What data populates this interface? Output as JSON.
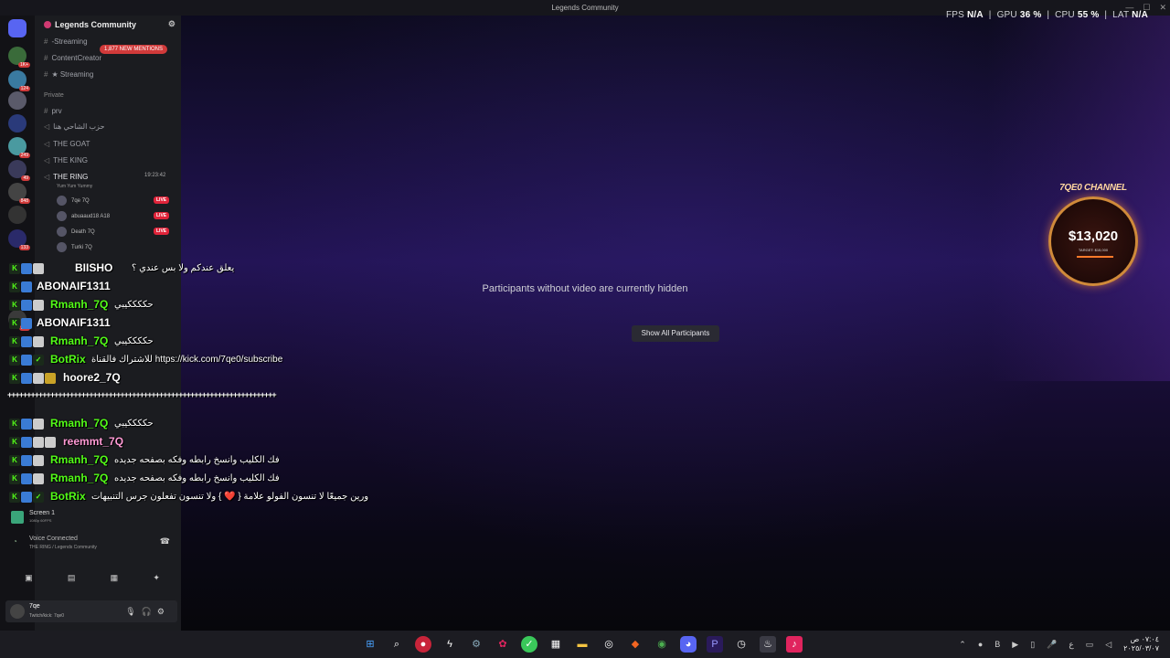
{
  "window": {
    "title": "Legends Community",
    "controls": [
      "—",
      "☐",
      "✕"
    ]
  },
  "stats": {
    "fps_label": "FPS",
    "fps": "N/A",
    "gpu_label": "GPU",
    "gpu": "36 %",
    "cpu_label": "CPU",
    "cpu": "55 %",
    "lat_label": "LAT",
    "lat": "N/A"
  },
  "stage": {
    "hidden_message": "Participants without video are currently hidden",
    "show_button": "Show All Participants"
  },
  "channel_widget": {
    "name": "7QE0 CHANNEL",
    "amount": "$13,020",
    "target": "TARGET: $15,000",
    "accent": "#d08a3a",
    "progress": 0.87
  },
  "discord": {
    "server_name": "Legends Community",
    "mentions_badge": "1,877 NEW MENTIONS",
    "server_badges": [
      "1K+",
      "124",
      "249",
      "49",
      "848",
      "133",
      "907"
    ],
    "channels": [
      {
        "name": "-Streaming"
      },
      {
        "name": "ContentCreator"
      },
      {
        "name": "★ Streaming"
      }
    ],
    "category_private": "Private",
    "private_channels": [
      "prv",
      "حزب الشاحي هنا",
      "THE GOAT",
      "THE KING"
    ],
    "voice_channel": {
      "name": "THE RING",
      "status": "Yum Yum Yummy",
      "timer": "19:23:42"
    },
    "voice_users": [
      {
        "name": "7qe",
        "tag": "7Q",
        "live": "LIVE"
      },
      {
        "name": "abuaaud18",
        "tag": "A18",
        "live": "LIVE"
      },
      {
        "name": "Death",
        "tag": "7Q",
        "live": "LIVE"
      },
      {
        "name": "Turki",
        "tag": "7Q"
      }
    ],
    "screen": {
      "title": "Screen 1",
      "detail": "1080p 60FPS"
    },
    "voice_connected": {
      "title": "Voice Connected",
      "detail": "THE RING / Legends Community"
    },
    "user": {
      "name": "7qe",
      "status": "Twitch/kick: 7qe0"
    }
  },
  "chat": [
    {
      "user": "BIISHO",
      "text": "يعلق عندكم ولا بس عندي ؟",
      "color": "#ffffff"
    },
    {
      "user": "ABONAIF1311",
      "text": "",
      "color": "#ffffff"
    },
    {
      "user": "Rmanh_7Q",
      "text": "حككككيبي",
      "color": "#53fc18"
    },
    {
      "user": "ABONAIF1311",
      "text": "",
      "color": "#ffffff"
    },
    {
      "user": "Rmanh_7Q",
      "text": "حككككيبي",
      "color": "#53fc18"
    },
    {
      "user": "BotRix",
      "text": "للاشتراك فالقناة https://kick.com/7qe0/subscribe",
      "color": "#53fc18"
    },
    {
      "user": "hoore2_7Q",
      "text": "",
      "color": "#ffffff"
    },
    {
      "user": "Rmanh_7Q",
      "text": "حككككيبي",
      "color": "#53fc18"
    },
    {
      "user": "reemmt_7Q",
      "text": "",
      "color": "#ff9ad5"
    },
    {
      "user": "Rmanh_7Q",
      "text": "فك الكليب وانسخ رابطه وفكه بصفحه جديده",
      "color": "#53fc18"
    },
    {
      "user": "Rmanh_7Q",
      "text": "فك الكليب وانسخ رابطه وفكه بصفحه جديده",
      "color": "#53fc18"
    },
    {
      "user": "BotRix",
      "text": "ورين جميعًا لا تنسون الفولو علامة { ❤️ } ولا تنسون تفعلون جرس التنبيهات",
      "color": "#53fc18"
    }
  ],
  "dash_line": "+++++++++++++++++++++++++++++++++++++++++++++++++++++++++++++++++++++",
  "taskbar": {
    "icons": [
      "windows-icon",
      "search-icon",
      "red-app-icon",
      "thunder-icon",
      "settings-icon",
      "bug-icon",
      "green-app-icon",
      "editor-icon",
      "folder-icon",
      "obs-icon",
      "brave-icon",
      "chrome-icon",
      "discord-icon",
      "premiere-icon",
      "clock-app-icon",
      "steam-icon",
      "tiktok-icon"
    ],
    "time": "٠٧:٠٤ ص",
    "date": "٢٠٢٥/٠٣/٠٧",
    "lang": "ع"
  }
}
